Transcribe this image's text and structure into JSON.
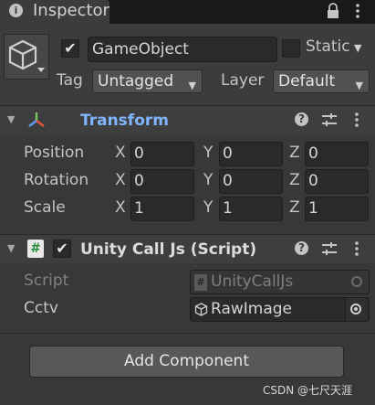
{
  "tab": {
    "title": "Inspector",
    "icon": "info-icon"
  },
  "window_icons": [
    "lock-icon",
    "kebab-menu-icon"
  ],
  "object": {
    "active": true,
    "name": "GameObject",
    "static_label": "Static",
    "static_checked": false,
    "tag_label": "Tag",
    "tag_value": "Untagged",
    "layer_label": "Layer",
    "layer_value": "Default",
    "icon": "cube-icon"
  },
  "transform": {
    "title": "Transform",
    "icon": "transform-axes-icon",
    "rows": [
      {
        "label": "Position",
        "x": "0",
        "y": "0",
        "z": "0"
      },
      {
        "label": "Rotation",
        "x": "0",
        "y": "0",
        "z": "0"
      },
      {
        "label": "Scale",
        "x": "1",
        "y": "1",
        "z": "1"
      }
    ],
    "axis_labels": {
      "x": "X",
      "y": "Y",
      "z": "Z"
    }
  },
  "script_component": {
    "title": "Unity Call Js (Script)",
    "enabled": true,
    "icon": "csharp-script-icon",
    "script_label": "Script",
    "script_value": "UnityCallJs",
    "cctv_label": "Cctv",
    "cctv_value": "RawImage"
  },
  "component_icons": [
    "help-icon",
    "preset-icon",
    "kebab-menu-icon"
  ],
  "add_component": "Add Component",
  "watermark": "CSDN @七尺天涯",
  "colors": {
    "transform_title": "#7fb4ff",
    "background": "#383838",
    "header": "#3e3e3e"
  }
}
